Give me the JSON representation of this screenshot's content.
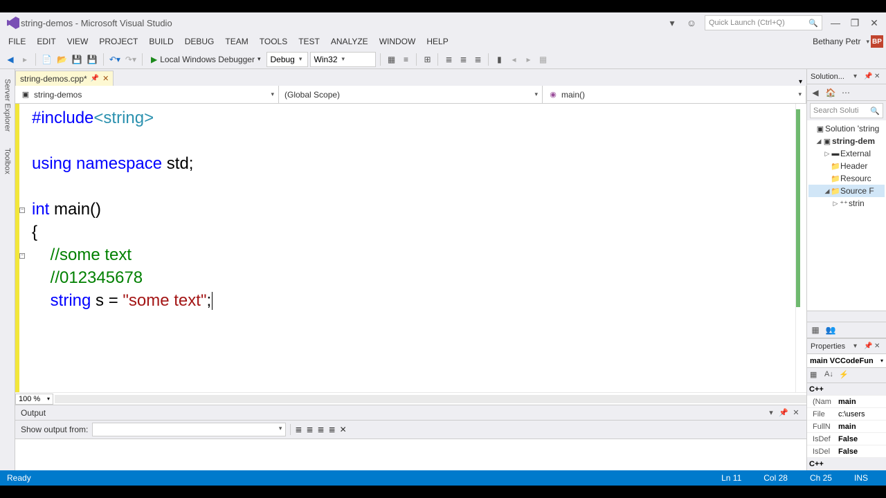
{
  "title": "string-demos - Microsoft Visual Studio",
  "quick_launch_placeholder": "Quick Launch (Ctrl+Q)",
  "menu": [
    "FILE",
    "EDIT",
    "VIEW",
    "PROJECT",
    "BUILD",
    "DEBUG",
    "TEAM",
    "TOOLS",
    "TEST",
    "ANALYZE",
    "WINDOW",
    "HELP"
  ],
  "user": "Bethany Petr",
  "user_initials": "BP",
  "toolbar": {
    "debugger_label": "Local Windows Debugger",
    "config": "Debug",
    "platform": "Win32"
  },
  "left_tabs": [
    "Server Explorer",
    "Toolbox"
  ],
  "tab": {
    "name": "string-demos.cpp*"
  },
  "crumbs": {
    "project": "string-demos",
    "scope": "(Global Scope)",
    "func": "main()"
  },
  "code": {
    "l1a": "#include",
    "l1b": "<string>",
    "l2a": "using",
    "l2b": " ",
    "l2c": "namespace",
    "l2d": " std;",
    "l3a": "int",
    "l3b": " main()",
    "l4": "{",
    "l5": "    //some text",
    "l6": "    //012345678",
    "l7a": "    ",
    "l7b": "string",
    "l7c": " s = ",
    "l7d": "\"some text\"",
    "l7e": ";"
  },
  "zoom": "100 %",
  "output": {
    "title": "Output",
    "show_from": "Show output from:"
  },
  "solution": {
    "title": "Solution...",
    "search_placeholder": "Search Soluti",
    "root": "Solution 'string",
    "proj": "string-dem",
    "nodes": [
      "External",
      "Header",
      "Resourc",
      "Source F"
    ],
    "file": "strin"
  },
  "props": {
    "title": "Properties",
    "combo": "main VCCodeFun",
    "cat1": "C++",
    "rows": [
      {
        "k": "(Nam",
        "v": "main"
      },
      {
        "k": "File",
        "v": "c:\\users"
      },
      {
        "k": "FullN",
        "v": "main"
      },
      {
        "k": "IsDef",
        "v": "False"
      },
      {
        "k": "IsDel",
        "v": "False"
      }
    ],
    "cat2": "C++"
  },
  "status": {
    "ready": "Ready",
    "ln": "Ln 11",
    "col": "Col 28",
    "ch": "Ch 25",
    "ins": "INS"
  }
}
